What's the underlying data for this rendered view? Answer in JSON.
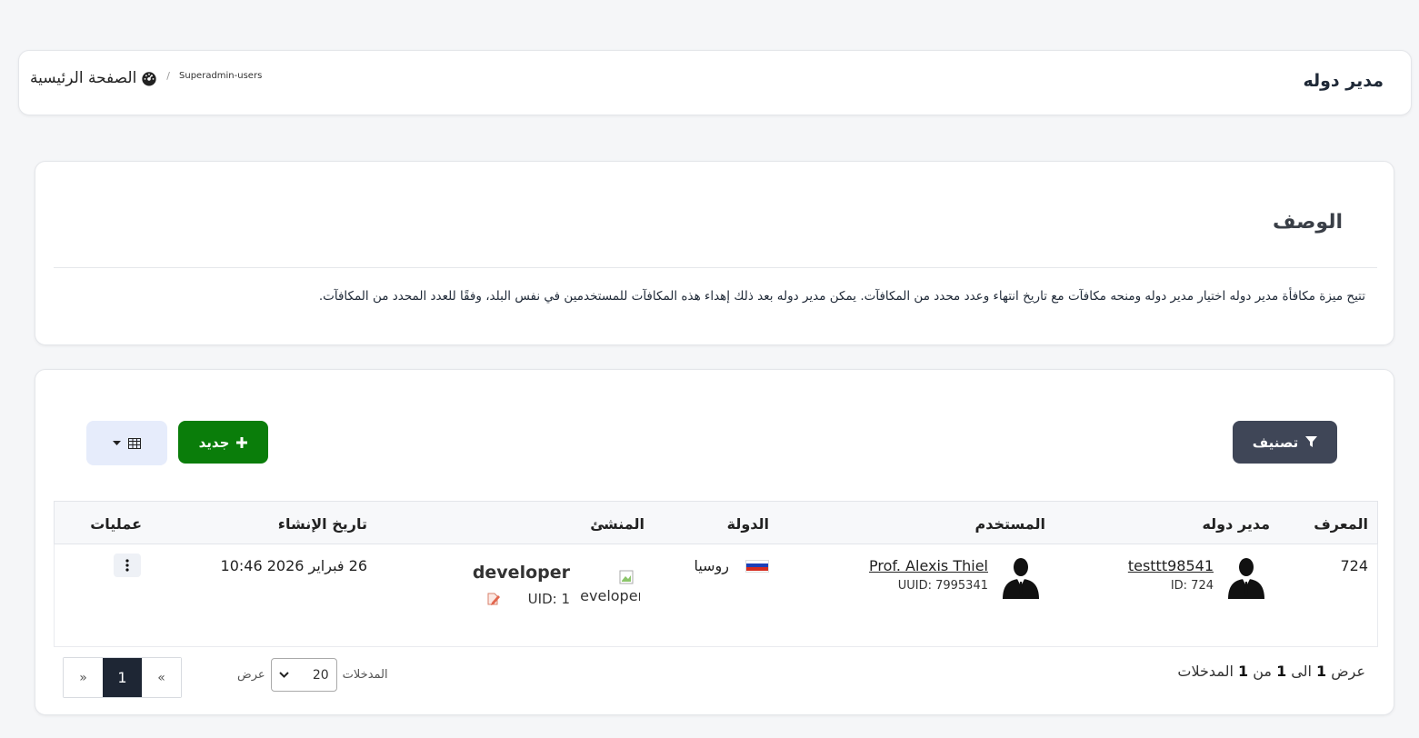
{
  "header": {
    "page_title": "مدير دوله",
    "breadcrumb_home": "الصفحة الرئيسية",
    "breadcrumb_separator": "/",
    "breadcrumb_current": "Superadmin-users"
  },
  "description": {
    "title": "الوصف",
    "text": "تتيح ميزة مكافأة مدير دوله اختيار مدير دوله ومنحه مكافآت مع تاريخ انتهاء وعدد محدد من المكافآت. يمكن مدير دوله بعد ذلك إهداء هذه المكافآت للمستخدمين في نفس البلد، وفقًا للعدد المحدد من المكافآت."
  },
  "toolbar": {
    "filter_label": "تصنيف",
    "new_label": "جديد",
    "columns_icon": "table-icon"
  },
  "table": {
    "headers": {
      "id": "المعرف",
      "manager": "مدير دوله",
      "user": "المستخدم",
      "country": "الدولة",
      "creator": "المنشئ",
      "created_at": "تاريخ الإنشاء",
      "actions": "عمليات"
    },
    "rows": [
      {
        "id": "724",
        "manager_name": "testtt98541",
        "manager_sub": "ID: 724",
        "user_name": "Prof. Alexis Thiel",
        "user_sub": "UUID: 7995341",
        "country": "روسيا",
        "creator_img_alt": "developer",
        "creator_name": "developer",
        "creator_uid": "UID: 1",
        "created_at": "26 فبراير 2026 10:46"
      }
    ]
  },
  "footer": {
    "info_prefix": "عرض",
    "info_from": "1",
    "info_to_word": "الى",
    "info_to": "1",
    "info_of_word": "من",
    "info_total": "1",
    "info_suffix": "المدخلات",
    "length_label_before": "عرض",
    "length_value": "20",
    "length_label_after": "المدخلات",
    "page_prev": "«",
    "page_current": "1",
    "page_next": "»"
  },
  "colors": {
    "filter_button": "#3f4657",
    "new_button": "#0a7d0a",
    "active_page": "#1e2634"
  }
}
